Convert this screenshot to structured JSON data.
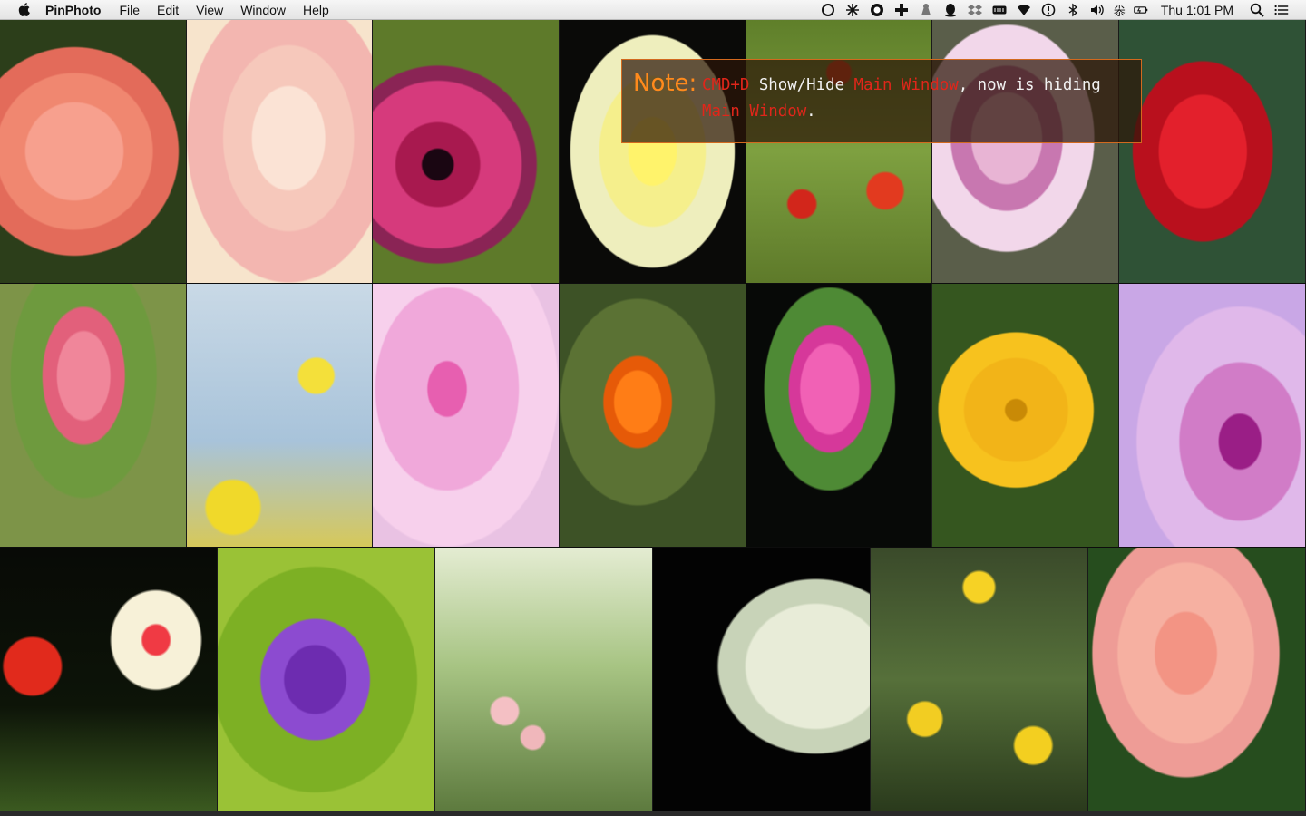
{
  "menubar": {
    "app_name": "PinPhoto",
    "items": [
      "File",
      "Edit",
      "View",
      "Window",
      "Help"
    ],
    "status_icons": [
      "circle-app-icon",
      "fan-icon",
      "timer-icon",
      "plus-app-icon",
      "alfred-icon",
      "qq-icon",
      "dropbox-icon",
      "battery-meter-icon",
      "wifi-icon",
      "alert-icon",
      "bluetooth-icon",
      "volume-icon"
    ],
    "input_method": "尜",
    "clock": "Thu 1:01 PM"
  },
  "note": {
    "label": "Note:",
    "shortcut": "CMD+D",
    "text1": " Show/Hide ",
    "target1": "Main Window",
    "text2": ", now is hiding ",
    "target2": "Main Window",
    "text3": ".",
    "accent_color": "#ff8a1c",
    "highlight_color": "#e0261a"
  },
  "photos": {
    "row1": [
      "coral rose",
      "peach rose petals",
      "magenta petunia",
      "yellow rose",
      "poppy meadow",
      "pink orchid",
      "red rose"
    ],
    "row2": [
      "pink rose bud",
      "yellow daisies sky",
      "pink azalea",
      "orange poppy",
      "pink mallow",
      "yellow sunflower",
      "purple passion flower"
    ],
    "row3": [
      "white red tulip",
      "purple alfalfa",
      "garden roses",
      "white calla lily",
      "yellow cosmos",
      "salmon rose"
    ]
  }
}
